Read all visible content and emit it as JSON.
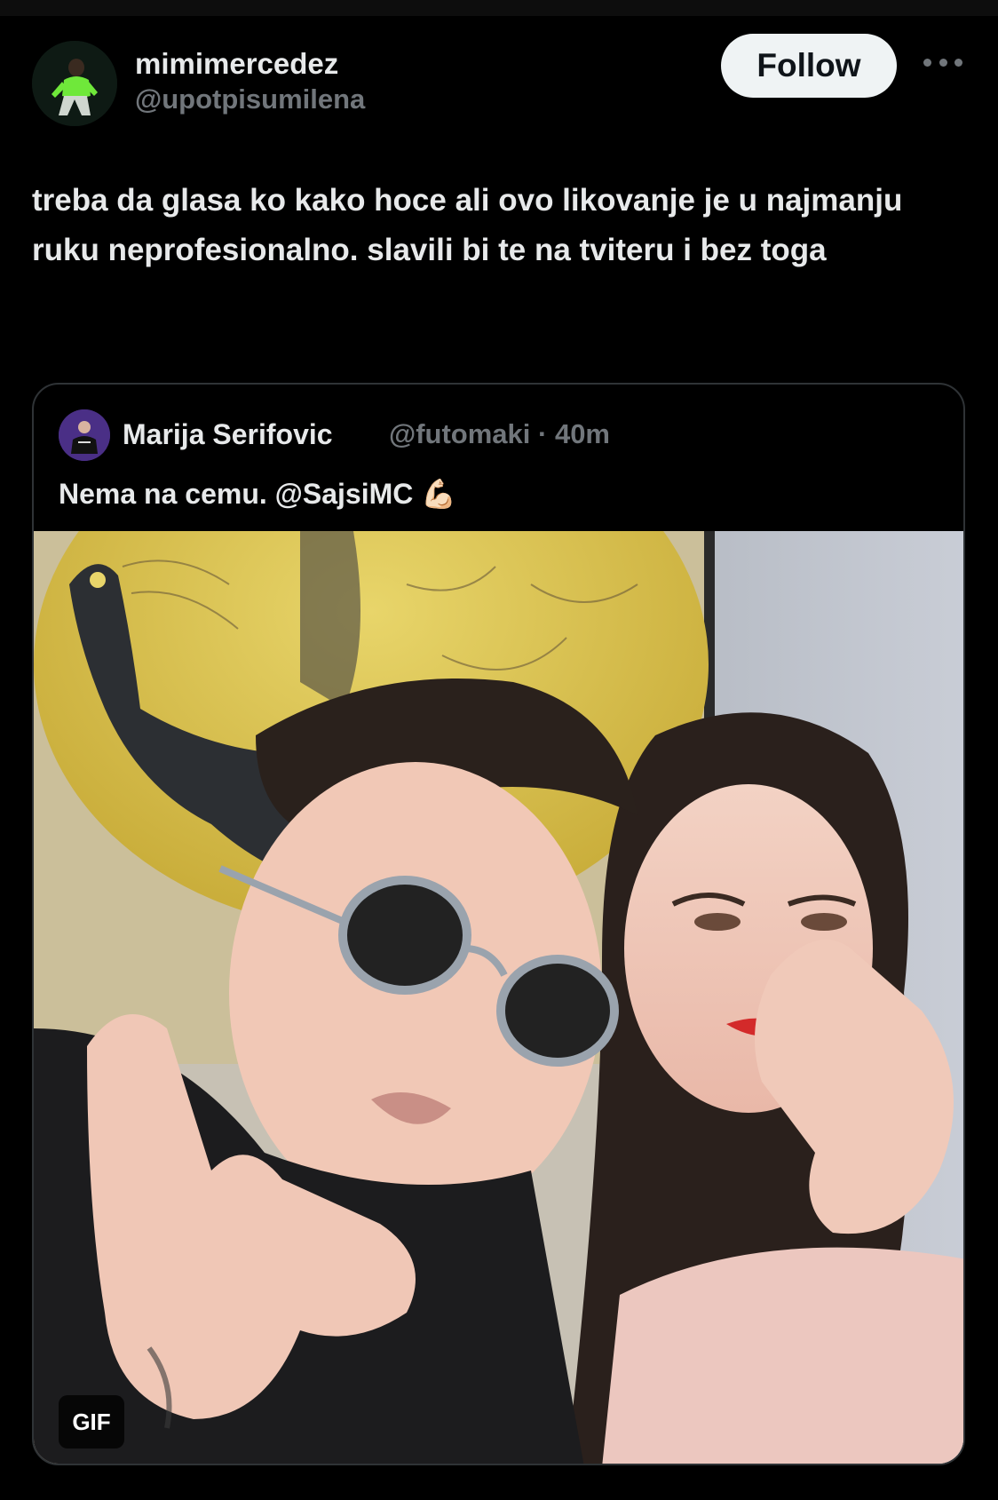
{
  "author": {
    "display_name": "mimimercedez",
    "handle": "@upotpisumilena"
  },
  "follow_label": "Follow",
  "tweet": {
    "text": "treba da glasa ko kako hoce ali ovo likovanje je u najmanju ruku neprofesionalno. slavili bi te na tviteru i bez toga"
  },
  "quoted": {
    "display_name": "Marija Serifovic",
    "handle_time": "@futomaki · 40m",
    "text": "Nema na cemu. @SajsiMC 💪🏻",
    "media_badge": "GIF"
  },
  "colors": {
    "background": "#000000",
    "text_primary": "#e7e9ea",
    "text_secondary": "#71767b",
    "follow_bg": "#eff3f4",
    "border": "#2f3336"
  },
  "icons": {
    "more": "more-horizontal-icon"
  }
}
